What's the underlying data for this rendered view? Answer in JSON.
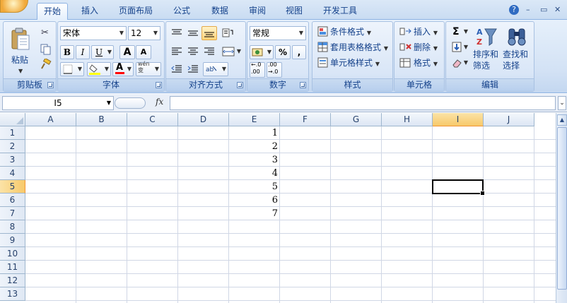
{
  "tabs": [
    {
      "label": "开始",
      "active": true
    },
    {
      "label": "插入"
    },
    {
      "label": "页面布局"
    },
    {
      "label": "公式"
    },
    {
      "label": "数据"
    },
    {
      "label": "审阅"
    },
    {
      "label": "视图"
    },
    {
      "label": "开发工具"
    }
  ],
  "window_controls": {
    "help": "?",
    "minimize": "–",
    "restore": "▭",
    "close": "✕"
  },
  "clipboard": {
    "paste_label": "粘贴",
    "group_title": "剪贴板"
  },
  "font": {
    "name": "宋体",
    "size": "12",
    "bold": "B",
    "italic": "I",
    "underline": "U",
    "grow": "A",
    "shrink": "A",
    "phonetic": "wén\n变",
    "group_title": "字体"
  },
  "alignment": {
    "group_title": "对齐方式"
  },
  "number": {
    "format": "常规",
    "percent": "%",
    "comma": ",",
    "inc_decimal": "←.0\n.00",
    "dec_decimal": ".00\n→.0",
    "group_title": "数字"
  },
  "styles": {
    "conditional": "条件格式",
    "table_format": "套用表格格式",
    "cell_styles": "单元格样式",
    "group_title": "样式"
  },
  "cells": {
    "insert": "插入",
    "delete": "删除",
    "format": "格式",
    "group_title": "单元格"
  },
  "editing": {
    "sigma": "Σ",
    "sort_filter": "排序和\n筛选",
    "find_select": "查找和\n选择",
    "group_title": "编辑"
  },
  "formula_bar": {
    "name_box": "I5",
    "fx": "fx",
    "value": ""
  },
  "sheet": {
    "columns": [
      "A",
      "B",
      "C",
      "D",
      "E",
      "F",
      "G",
      "H",
      "I",
      "J"
    ],
    "rows": [
      "1",
      "2",
      "3",
      "4",
      "5",
      "6",
      "7",
      "8",
      "9",
      "10",
      "11",
      "12",
      "13"
    ],
    "selected_cell": "I5",
    "e_values": [
      "1",
      "2",
      "3",
      "4",
      "5",
      "6",
      "7"
    ]
  }
}
